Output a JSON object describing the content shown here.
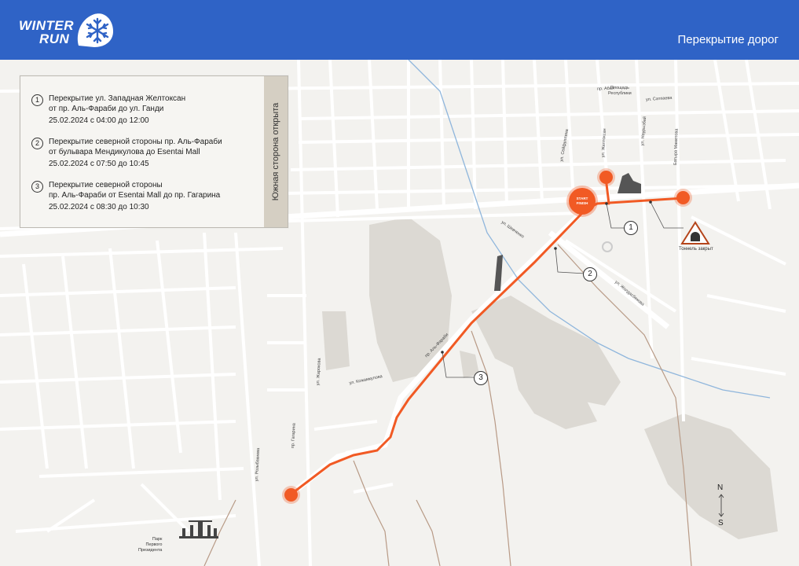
{
  "header": {
    "logo_line1": "WINTER",
    "logo_line2": "RUN",
    "title": "Перекрытие дорог",
    "background": "#2f63c6"
  },
  "legend": {
    "side_label": "Южная сторона открыта",
    "items": [
      {
        "number": "1",
        "line1": "Перекрытие ул. Западная Желтоксан",
        "line2": "от пр. Аль-Фараби до ул. Ганди",
        "date": "25.02.2024 с 04:00 до 12:00"
      },
      {
        "number": "2",
        "line1": "Перекрытие северной стороны пр. Аль-Фараби",
        "line2": "от бульвара Мендикулова до Esentai Mall",
        "date": "25.02.2024 с 07:50 до 10:45"
      },
      {
        "number": "3",
        "line1": "Перекрытие северной стороны",
        "line2": "пр. Аль-Фараби от Esentai Mall до пр. Гагарина",
        "date": "25.02.2024 с 08:30 до 10:30"
      }
    ]
  },
  "map": {
    "start_finish_line1": "START",
    "start_finish_line2": "FINISH",
    "callouts": [
      "1",
      "2",
      "3"
    ],
    "tunnel_label": "Тоннель закрыт",
    "park_label_line1": "Парк",
    "park_label_line2": "Первого",
    "park_label_line3": "Президента",
    "compass_north": "N",
    "compass_south": "S",
    "street_labels": {
      "abaya": "пр. Абая",
      "ploshad_line1": "Площадь",
      "ploshad_line2": "Республики",
      "satpaeva": "ул. Сатпаева",
      "seyfullina": "ул. Сейфуллина",
      "zheltoksan": "ул. Желтоксан",
      "nauryzbai": "ул. Наурызбай",
      "mametova": "Батыра Маметова",
      "shevchenko": "ул. Шевченко",
      "zholdasbekova": "ул. Жолдасбекова",
      "al_farabi": "пр. Аль-Фараби",
      "zharokova": "ул. Жарокова",
      "gagarina": "пр. Гагарина",
      "kozhamkulova": "ул. Кожамкулова",
      "rozybakieva": "ул. Розыбакиева"
    },
    "colors": {
      "route": "#f15a24",
      "river": "#8fb6dc",
      "park": "#d8d5cf",
      "road": "#ffffff",
      "background": "#f3f2ef"
    }
  }
}
